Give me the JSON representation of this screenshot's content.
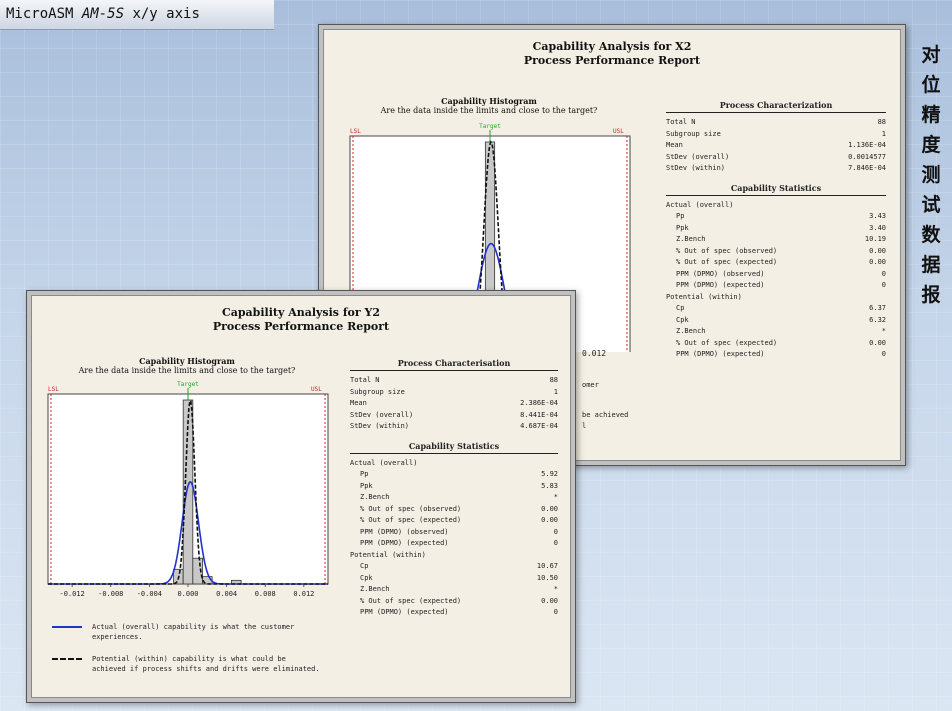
{
  "slide": {
    "title_plain": "MicroASM ",
    "title_italic": "AM-5S",
    "title_rest": " x/y axis",
    "vertical_text": [
      "对",
      "位",
      "精",
      "度",
      "测",
      "试",
      "数",
      "据",
      "报"
    ]
  },
  "colors": {
    "actual": "#2233cc",
    "potential": "#111111",
    "spec": "#cc2222",
    "target": "#22aa22",
    "bar": "#c8c8c8"
  },
  "reports": {
    "x2": {
      "title1": "Capability Analysis for X2",
      "title2": "Process Performance Report",
      "hist_title": "Capability Histogram",
      "hist_sub": "Are the data inside the limits and close to the target?",
      "lsl": "LSL",
      "target": "Target",
      "usl": "USL",
      "axis_fragment": "0.012",
      "legend_fragment_1": "omer",
      "legend_fragment_2": "be achieved",
      "legend_fragment_3": "l",
      "pc_header": "Process Characterization",
      "pc": [
        {
          "k": "Total N",
          "v": "88"
        },
        {
          "k": "Subgroup size",
          "v": "1"
        },
        {
          "k": "Mean",
          "v": "1.136E-04"
        },
        {
          "k": "StDev (overall)",
          "v": "0.0014577"
        },
        {
          "k": "StDev (within)",
          "v": "7.846E-04"
        }
      ],
      "cs_header": "Capability Statistics",
      "actual_label": "Actual (overall)",
      "actual": [
        {
          "k": "Pp",
          "v": "3.43"
        },
        {
          "k": "Ppk",
          "v": "3.40"
        },
        {
          "k": "Z.Bench",
          "v": "10.19"
        },
        {
          "k": "% Out of spec (observed)",
          "v": "0.00"
        },
        {
          "k": "% Out of spec (expected)",
          "v": "0.00"
        },
        {
          "k": "PPM (DPMO) (observed)",
          "v": "0"
        },
        {
          "k": "PPM (DPMO) (expected)",
          "v": "0"
        }
      ],
      "potential_label": "Potential (within)",
      "potential": [
        {
          "k": "Cp",
          "v": "6.37"
        },
        {
          "k": "Cpk",
          "v": "6.32"
        },
        {
          "k": "Z.Bench",
          "v": "*"
        },
        {
          "k": "% Out of spec (expected)",
          "v": "0.00"
        },
        {
          "k": "PPM (DPMO) (expected)",
          "v": "0"
        }
      ]
    },
    "y2": {
      "title1": "Capability Analysis for Y2",
      "title2": "Process Performance Report",
      "hist_title": "Capability Histogram",
      "hist_sub": "Are the data inside the limits and close to the target?",
      "lsl": "LSL",
      "target": "Target",
      "usl": "USL",
      "pc_header": "Process Characterisation",
      "pc": [
        {
          "k": "Total N",
          "v": "88"
        },
        {
          "k": "Subgroup size",
          "v": "1"
        },
        {
          "k": "Mean",
          "v": "2.386E-04"
        },
        {
          "k": "StDev (overall)",
          "v": "8.441E-04"
        },
        {
          "k": "StDev (within)",
          "v": "4.687E-04"
        }
      ],
      "cs_header": "Capability Statistics",
      "actual_label": "Actual (overall)",
      "actual": [
        {
          "k": "Pp",
          "v": "5.92"
        },
        {
          "k": "Ppk",
          "v": "5.83"
        },
        {
          "k": "Z.Bench",
          "v": "*"
        },
        {
          "k": "% Out of spec (observed)",
          "v": "0.00"
        },
        {
          "k": "% Out of spec (expected)",
          "v": "0.00"
        },
        {
          "k": "PPM (DPMO) (observed)",
          "v": "0"
        },
        {
          "k": "PPM (DPMO) (expected)",
          "v": "0"
        }
      ],
      "potential_label": "Potential (within)",
      "potential": [
        {
          "k": "Cp",
          "v": "10.67"
        },
        {
          "k": "Cpk",
          "v": "10.50"
        },
        {
          "k": "Z.Bench",
          "v": "*"
        },
        {
          "k": "% Out of spec (expected)",
          "v": "0.00"
        },
        {
          "k": "PPM (DPMO) (expected)",
          "v": "0"
        }
      ],
      "legend_actual": "Actual (overall) capability is what the customer experiences.",
      "legend_potential": "Potential (within) capability is what could be achieved if process shifts and drifts were eliminated."
    }
  },
  "chart_data": [
    {
      "type": "bar",
      "name": "X2 capability histogram",
      "xlim": [
        -0.015,
        0.015
      ],
      "ylim": [
        0,
        1
      ],
      "lsl": -0.015,
      "usl": 0.015,
      "target": 0,
      "bins": [
        {
          "x0": -0.0005,
          "x1": 0.0005,
          "h": 1.0
        }
      ],
      "mean": 0.0001136,
      "sd_overall": 0.0014577,
      "sd_within": 0.0007846
    },
    {
      "type": "bar",
      "name": "Y2 capability histogram",
      "xtick_labels": [
        "-0.012",
        "-0.008",
        "-0.004",
        "0.000",
        "0.004",
        "0.008",
        "0.012"
      ],
      "xticks": [
        -0.012,
        -0.008,
        -0.004,
        0,
        0.004,
        0.008,
        0.012
      ],
      "xlim": [
        -0.0145,
        0.0145
      ],
      "ylim": [
        0,
        1
      ],
      "lsl": -0.015,
      "usl": 0.015,
      "target": 0,
      "bins": [
        {
          "x0": -0.0015,
          "x1": -0.0005,
          "h": 0.08
        },
        {
          "x0": -0.0005,
          "x1": 0.0005,
          "h": 1.0
        },
        {
          "x0": 0.0005,
          "x1": 0.0015,
          "h": 0.14
        },
        {
          "x0": 0.0015,
          "x1": 0.0025,
          "h": 0.04
        },
        {
          "x0": 0.0045,
          "x1": 0.0055,
          "h": 0.02
        }
      ],
      "mean": 0.0002386,
      "sd_overall": 0.0008441,
      "sd_within": 0.0004687
    }
  ]
}
